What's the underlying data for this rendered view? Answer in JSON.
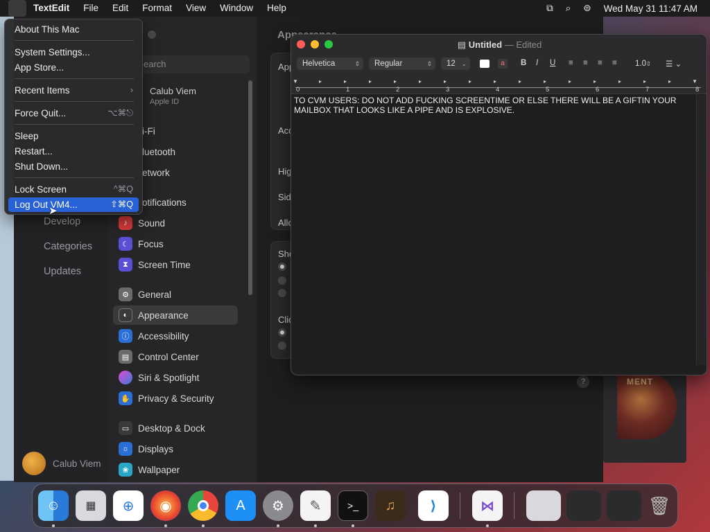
{
  "menubar": {
    "apple_symbol": "",
    "app_name": "TextEdit",
    "items": [
      "File",
      "Edit",
      "Format",
      "View",
      "Window",
      "Help"
    ],
    "datetime": "Wed May 31  11:47 AM",
    "icons": [
      "screen-mirroring-icon",
      "search-icon",
      "control-center-icon"
    ]
  },
  "apple_menu": {
    "items": [
      {
        "label": "About This Mac",
        "shortcut": ""
      },
      {
        "label": "System Settings...",
        "shortcut": ""
      },
      {
        "label": "App Store...",
        "shortcut": ""
      },
      {
        "label": "Recent Items",
        "shortcut": "›"
      },
      {
        "label": "Force Quit...",
        "shortcut": "⌥⌘⎋"
      },
      {
        "label": "Sleep",
        "shortcut": ""
      },
      {
        "label": "Restart...",
        "shortcut": ""
      },
      {
        "label": "Shut Down...",
        "shortcut": ""
      },
      {
        "label": "Lock Screen",
        "shortcut": "^⌘Q"
      },
      {
        "label": "Log Out VM4...",
        "shortcut": "⇧⌘Q"
      }
    ],
    "highlighted": "Log Out VM4..."
  },
  "store_sidebar": {
    "items": [
      "Develop",
      "Categories",
      "Updates"
    ],
    "user": "Calub Viem"
  },
  "settings": {
    "search_placeholder": "earch",
    "account_name": "Calub Viem",
    "account_sub": "Apple ID",
    "sidebar_items": [
      {
        "label": "i-Fi",
        "icon": "wifi-icon",
        "color": "#2a6fd6"
      },
      {
        "label": "luetooth",
        "icon": "bluetooth-icon",
        "color": "#2a6fd6"
      },
      {
        "label": "etwork",
        "icon": "network-icon",
        "color": "#2a6fd6"
      },
      {
        "label": "otifications",
        "icon": "notifications-icon",
        "color": "#d63b3b"
      },
      {
        "label": "Sound",
        "icon": "sound-icon",
        "color": "#d63b3b"
      },
      {
        "label": "Focus",
        "icon": "focus-icon",
        "color": "#5b4fd6"
      },
      {
        "label": "Screen Time",
        "icon": "screen-time-icon",
        "color": "#5b4fd6"
      },
      {
        "label": "General",
        "icon": "gear-icon",
        "color": "#6b6b6e"
      },
      {
        "label": "Appearance",
        "icon": "appearance-icon",
        "color": "#3a3a3c"
      },
      {
        "label": "Accessibility",
        "icon": "accessibility-icon",
        "color": "#2a6fd6"
      },
      {
        "label": "Control Center",
        "icon": "control-center-icon",
        "color": "#6b6b6e"
      },
      {
        "label": "Siri & Spotlight",
        "icon": "siri-icon",
        "color": "#b13dbf"
      },
      {
        "label": "Privacy & Security",
        "icon": "hand-icon",
        "color": "#2a6fd6"
      },
      {
        "label": "Desktop & Dock",
        "icon": "desktop-icon",
        "color": "#3a3a3c"
      },
      {
        "label": "Displays",
        "icon": "displays-icon",
        "color": "#2a6fd6"
      },
      {
        "label": "Wallpaper",
        "icon": "wallpaper-icon",
        "color": "#2aa6c6"
      }
    ],
    "selected": "Appearance",
    "content_title": "Appearance",
    "content_labels": [
      "App",
      "Acc",
      "Hig",
      "Sid",
      "Allo",
      "Sho",
      "Clic"
    ]
  },
  "art_card": {
    "text": "MENT"
  },
  "textedit": {
    "title": "Untitled",
    "separator": "—",
    "status": "Edited",
    "font_family": "Helvetica",
    "font_style": "Regular",
    "font_size": "12",
    "bold": "B",
    "italic": "I",
    "underline": "U",
    "line_spacing": "1.0",
    "ruler_numbers": [
      "0",
      "1",
      "2",
      "3",
      "4",
      "5",
      "6",
      "7",
      "8"
    ],
    "body_text": "TO CVM USERS: DO NOT ADD FUCKING SCREENTIME OR ELSE THERE WILL BE A  GIFTIN YOUR MAILBOX THAT LOOKS LIKE A PIPE AND IS EXPLOSIVE."
  },
  "dock": {
    "apps": [
      "Finder",
      "Launchpad",
      "Safari",
      "Firefox",
      "Chrome",
      "App Store",
      "System Settings",
      "TextEdit",
      "Terminal",
      "GarageBand",
      "Visual Studio Code",
      "Visual Studio",
      "Chrome Window",
      "Terminal Window",
      "Firefox Window",
      "Trash"
    ]
  }
}
